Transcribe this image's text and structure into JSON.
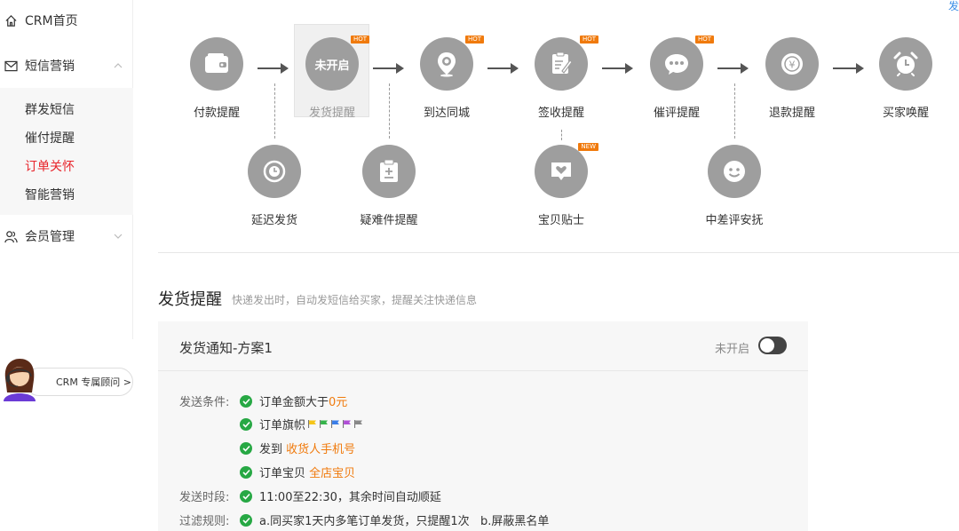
{
  "top_link": "发",
  "sidebar": {
    "items": [
      {
        "label": "CRM首页",
        "icon": "home-icon"
      },
      {
        "label": "短信营销",
        "icon": "mail-icon"
      },
      {
        "label": "会员管理",
        "icon": "members-icon"
      }
    ],
    "sub_items": [
      {
        "label": "群发短信"
      },
      {
        "label": "催付提醒"
      },
      {
        "label": "订单关怀",
        "active": true
      },
      {
        "label": "智能营销"
      }
    ],
    "advisor": "CRM 专属顾问 >"
  },
  "flow": {
    "main": [
      {
        "label": "付款提醒",
        "icon": "wallet-icon"
      },
      {
        "label": "发货提醒",
        "icon": "not-enabled",
        "inner_text": "未开启",
        "badge": "HOT"
      },
      {
        "label": "到达同城",
        "icon": "location-icon",
        "badge": "HOT"
      },
      {
        "label": "签收提醒",
        "icon": "sign-icon",
        "badge": "HOT"
      },
      {
        "label": "催评提醒",
        "icon": "chat-icon",
        "badge": "HOT"
      },
      {
        "label": "退款提醒",
        "icon": "refund-icon"
      },
      {
        "label": "买家唤醒",
        "icon": "alarm-icon"
      }
    ],
    "sub": [
      {
        "label": "延迟发货",
        "icon": "clock-icon"
      },
      {
        "label": "疑难件提醒",
        "icon": "clipboard-icon"
      },
      {
        "label": "宝贝贴士",
        "icon": "heart-card-icon",
        "badge": "NEW"
      },
      {
        "label": "中差评安抚",
        "icon": "smile-icon"
      }
    ]
  },
  "section": {
    "title": "发货提醒",
    "desc": "快递发出时，自动发短信给买家，提醒关注快递信息"
  },
  "panel": {
    "title": "发货通知-方案1",
    "status": "未开启",
    "conditions_label": "发送条件:",
    "c1a": "订单金额大于",
    "c1b": "0元",
    "c2": "订单旗帜",
    "flag_colors": [
      "#f5c518",
      "#35b34a",
      "#3a7ee8",
      "#b04fd6",
      "#888888"
    ],
    "c3a": "发到 ",
    "c3b": "收货人手机号",
    "c4a": "订单宝贝 ",
    "c4b": "全店宝贝",
    "time_label": "发送时段:",
    "time": "11:00至22:30，其余时间自动顺延",
    "filter_label": "过滤规则:",
    "filter": "a.同买家1天内多笔订单发货，只提醒1次   b.屏蔽黑名单"
  },
  "colors": {
    "accent_red": "#e8242b",
    "orange": "#f07a0c",
    "green": "#27a844",
    "node_gray": "#9e9e9e"
  }
}
